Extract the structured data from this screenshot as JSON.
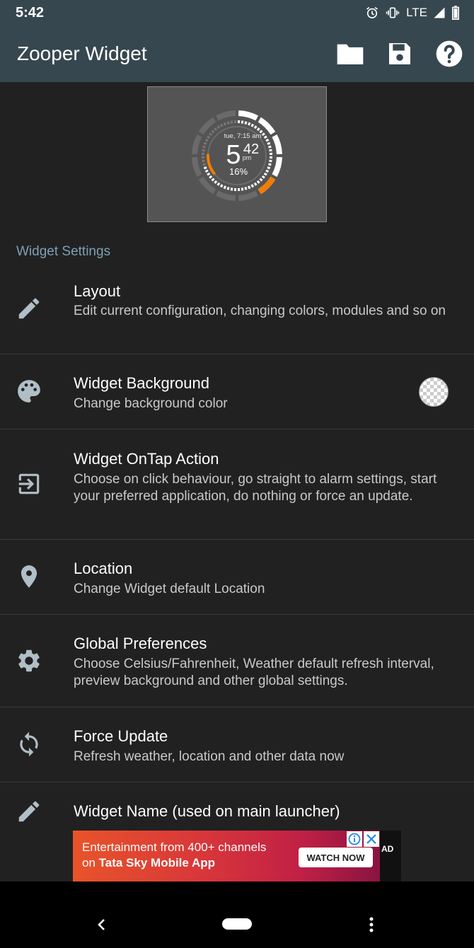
{
  "status": {
    "time": "5:42",
    "network": "LTE"
  },
  "app": {
    "title": "Zooper Widget",
    "actions": [
      "folder-icon",
      "save-icon",
      "help-icon"
    ]
  },
  "preview": {
    "date_text": "tue, 7:15 am",
    "hour": "5",
    "minute": "42",
    "ampm": "pm",
    "battery": "16%",
    "battery_level": 0.16
  },
  "section": {
    "header": "Widget Settings"
  },
  "settings": [
    {
      "icon": "pencil-icon",
      "title": "Layout",
      "subtitle": "Edit current configuration, changing colors, modules and so on"
    },
    {
      "icon": "palette-icon",
      "title": "Widget Background",
      "subtitle": "Change background color"
    },
    {
      "icon": "exit-to-app-icon",
      "title": "Widget OnTap Action",
      "subtitle": "Choose on click behaviour, go straight to alarm settings, start your preferred application, do nothing or force an update."
    },
    {
      "icon": "location-pin-icon",
      "title": "Location",
      "subtitle": "Change Widget default Location"
    },
    {
      "icon": "gear-icon",
      "title": "Global Preferences",
      "subtitle": "Choose Celsius/Fahrenheit, Weather default refresh interval, preview background and other global settings."
    },
    {
      "icon": "sync-icon",
      "title": "Force Update",
      "subtitle": "Refresh weather, location and other data now"
    },
    {
      "icon": "pencil-icon",
      "title": "Widget Name (used on main launcher)",
      "subtitle": ""
    }
  ],
  "ad": {
    "line1": "Entertainment from 400+ channels",
    "line2_prefix": "on ",
    "line2_bold": "Tata Sky Mobile App",
    "cta": "WATCH NOW",
    "label": "AD"
  },
  "colors": {
    "appbar": "#37474f",
    "background": "#212121",
    "accent": "#7ea0b5",
    "widget_orange": "#f57c00"
  }
}
